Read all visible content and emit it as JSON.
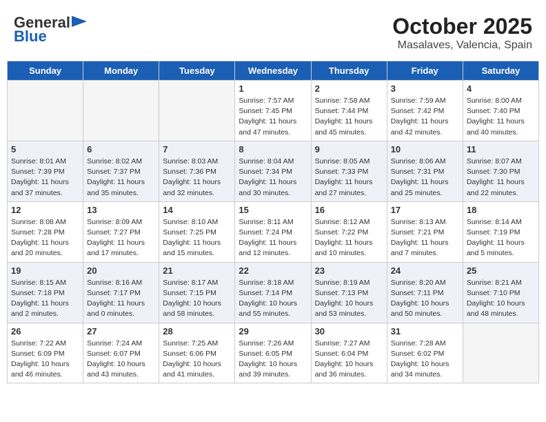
{
  "header": {
    "logo_general": "General",
    "logo_blue": "Blue",
    "month_title": "October 2025",
    "subtitle": "Masalaves, Valencia, Spain"
  },
  "weekdays": [
    "Sunday",
    "Monday",
    "Tuesday",
    "Wednesday",
    "Thursday",
    "Friday",
    "Saturday"
  ],
  "weeks": [
    [
      {
        "day": "",
        "info": ""
      },
      {
        "day": "",
        "info": ""
      },
      {
        "day": "",
        "info": ""
      },
      {
        "day": "1",
        "info": "Sunrise: 7:57 AM\nSunset: 7:45 PM\nDaylight: 11 hours and 47 minutes."
      },
      {
        "day": "2",
        "info": "Sunrise: 7:58 AM\nSunset: 7:44 PM\nDaylight: 11 hours and 45 minutes."
      },
      {
        "day": "3",
        "info": "Sunrise: 7:59 AM\nSunset: 7:42 PM\nDaylight: 11 hours and 42 minutes."
      },
      {
        "day": "4",
        "info": "Sunrise: 8:00 AM\nSunset: 7:40 PM\nDaylight: 11 hours and 40 minutes."
      }
    ],
    [
      {
        "day": "5",
        "info": "Sunrise: 8:01 AM\nSunset: 7:39 PM\nDaylight: 11 hours and 37 minutes."
      },
      {
        "day": "6",
        "info": "Sunrise: 8:02 AM\nSunset: 7:37 PM\nDaylight: 11 hours and 35 minutes."
      },
      {
        "day": "7",
        "info": "Sunrise: 8:03 AM\nSunset: 7:36 PM\nDaylight: 11 hours and 32 minutes."
      },
      {
        "day": "8",
        "info": "Sunrise: 8:04 AM\nSunset: 7:34 PM\nDaylight: 11 hours and 30 minutes."
      },
      {
        "day": "9",
        "info": "Sunrise: 8:05 AM\nSunset: 7:33 PM\nDaylight: 11 hours and 27 minutes."
      },
      {
        "day": "10",
        "info": "Sunrise: 8:06 AM\nSunset: 7:31 PM\nDaylight: 11 hours and 25 minutes."
      },
      {
        "day": "11",
        "info": "Sunrise: 8:07 AM\nSunset: 7:30 PM\nDaylight: 11 hours and 22 minutes."
      }
    ],
    [
      {
        "day": "12",
        "info": "Sunrise: 8:08 AM\nSunset: 7:28 PM\nDaylight: 11 hours and 20 minutes."
      },
      {
        "day": "13",
        "info": "Sunrise: 8:09 AM\nSunset: 7:27 PM\nDaylight: 11 hours and 17 minutes."
      },
      {
        "day": "14",
        "info": "Sunrise: 8:10 AM\nSunset: 7:25 PM\nDaylight: 11 hours and 15 minutes."
      },
      {
        "day": "15",
        "info": "Sunrise: 8:11 AM\nSunset: 7:24 PM\nDaylight: 11 hours and 12 minutes."
      },
      {
        "day": "16",
        "info": "Sunrise: 8:12 AM\nSunset: 7:22 PM\nDaylight: 11 hours and 10 minutes."
      },
      {
        "day": "17",
        "info": "Sunrise: 8:13 AM\nSunset: 7:21 PM\nDaylight: 11 hours and 7 minutes."
      },
      {
        "day": "18",
        "info": "Sunrise: 8:14 AM\nSunset: 7:19 PM\nDaylight: 11 hours and 5 minutes."
      }
    ],
    [
      {
        "day": "19",
        "info": "Sunrise: 8:15 AM\nSunset: 7:18 PM\nDaylight: 11 hours and 2 minutes."
      },
      {
        "day": "20",
        "info": "Sunrise: 8:16 AM\nSunset: 7:17 PM\nDaylight: 11 hours and 0 minutes."
      },
      {
        "day": "21",
        "info": "Sunrise: 8:17 AM\nSunset: 7:15 PM\nDaylight: 10 hours and 58 minutes."
      },
      {
        "day": "22",
        "info": "Sunrise: 8:18 AM\nSunset: 7:14 PM\nDaylight: 10 hours and 55 minutes."
      },
      {
        "day": "23",
        "info": "Sunrise: 8:19 AM\nSunset: 7:13 PM\nDaylight: 10 hours and 53 minutes."
      },
      {
        "day": "24",
        "info": "Sunrise: 8:20 AM\nSunset: 7:11 PM\nDaylight: 10 hours and 50 minutes."
      },
      {
        "day": "25",
        "info": "Sunrise: 8:21 AM\nSunset: 7:10 PM\nDaylight: 10 hours and 48 minutes."
      }
    ],
    [
      {
        "day": "26",
        "info": "Sunrise: 7:22 AM\nSunset: 6:09 PM\nDaylight: 10 hours and 46 minutes."
      },
      {
        "day": "27",
        "info": "Sunrise: 7:24 AM\nSunset: 6:07 PM\nDaylight: 10 hours and 43 minutes."
      },
      {
        "day": "28",
        "info": "Sunrise: 7:25 AM\nSunset: 6:06 PM\nDaylight: 10 hours and 41 minutes."
      },
      {
        "day": "29",
        "info": "Sunrise: 7:26 AM\nSunset: 6:05 PM\nDaylight: 10 hours and 39 minutes."
      },
      {
        "day": "30",
        "info": "Sunrise: 7:27 AM\nSunset: 6:04 PM\nDaylight: 10 hours and 36 minutes."
      },
      {
        "day": "31",
        "info": "Sunrise: 7:28 AM\nSunset: 6:02 PM\nDaylight: 10 hours and 34 minutes."
      },
      {
        "day": "",
        "info": ""
      }
    ]
  ]
}
